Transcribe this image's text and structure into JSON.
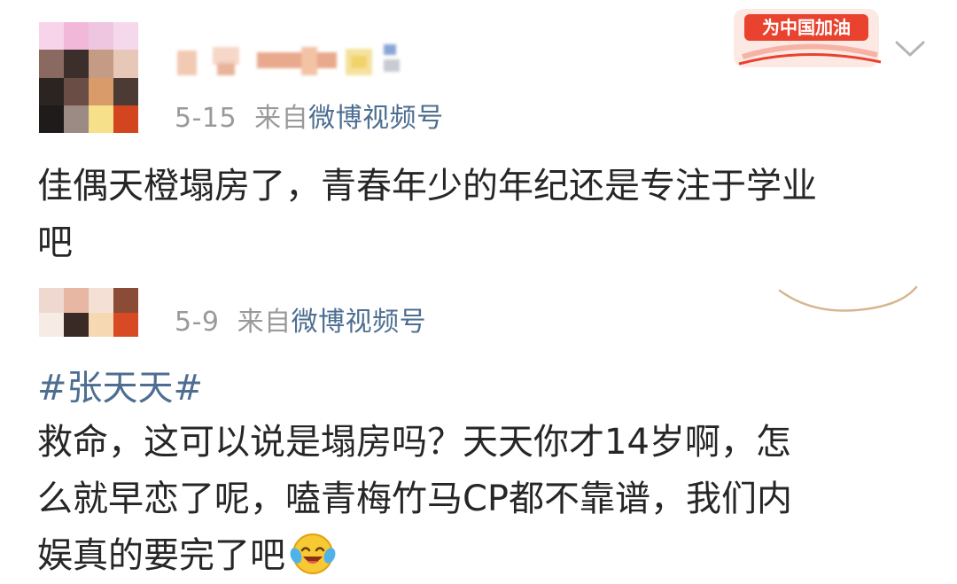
{
  "posts": [
    {
      "date": "5-15",
      "source_prefix": "来自",
      "source": "微博视频号",
      "text_lines": [
        "佳偶天橙塌房了，青春年少的年纪还是专注于学业",
        "吧"
      ]
    },
    {
      "date": "5-9",
      "source_prefix": "来自",
      "source": "微博视频号",
      "hashtag": "#张天天#",
      "text_lines": [
        "救命，这可以说是塌房吗？天天你才14岁啊，怎",
        "么就早恋了呢，嗑青梅竹马CP都不靠谱，我们内",
        "娱真的要完了吧"
      ]
    }
  ],
  "badge": {
    "label": "为中国加油"
  },
  "colors": {
    "link": "#4d6e91",
    "meta": "#9a9a9a",
    "text": "#262626",
    "badge_red": "#e9422e",
    "badge_bg": "#fde9e4"
  },
  "icons": {
    "expand": "chevron-down-icon",
    "emoji": "laugh-cry-emoji-icon"
  }
}
